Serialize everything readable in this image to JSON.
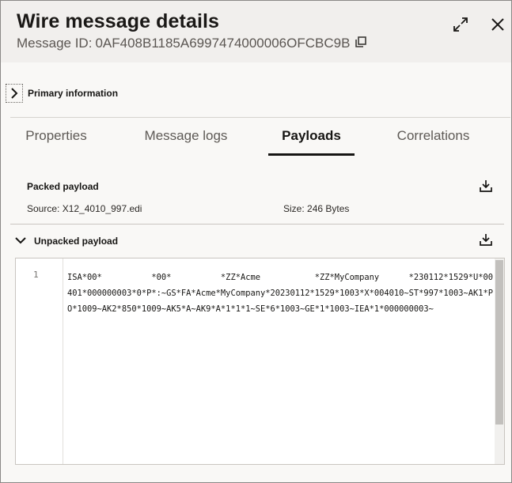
{
  "header": {
    "title": "Wire message details",
    "message_id_label": "Message ID:",
    "message_id": "0AF408B1185A6997474000006OFCBC9B"
  },
  "primary": {
    "label": "Primary information"
  },
  "tabs": [
    {
      "label": "Properties",
      "active": false
    },
    {
      "label": "Message logs",
      "active": false
    },
    {
      "label": "Payloads",
      "active": true
    },
    {
      "label": "Correlations",
      "active": false
    }
  ],
  "packed": {
    "title": "Packed payload",
    "source_label": "Source:",
    "source": "X12_4010_997.edi",
    "size_label": "Size:",
    "size": "246 Bytes"
  },
  "unpacked": {
    "title": "Unpacked payload",
    "line_number": "1",
    "content": "ISA*00*          *00*          *ZZ*Acme           *ZZ*MyCompany      *230112*1529*U*00401*000000003*0*P*:~GS*FA*Acme*MyCompany*20230112*1529*1003*X*004010~ST*997*1003~AK1*PO*1009~AK2*850*1009~AK5*A~AK9*A*1*1*1~SE*6*1003~GE*1*1003~IEA*1*000000003~"
  },
  "icons": [
    "copy-icon",
    "expand-icon",
    "close-icon",
    "chevron-right-icon",
    "chevron-down-icon",
    "download-icon"
  ]
}
